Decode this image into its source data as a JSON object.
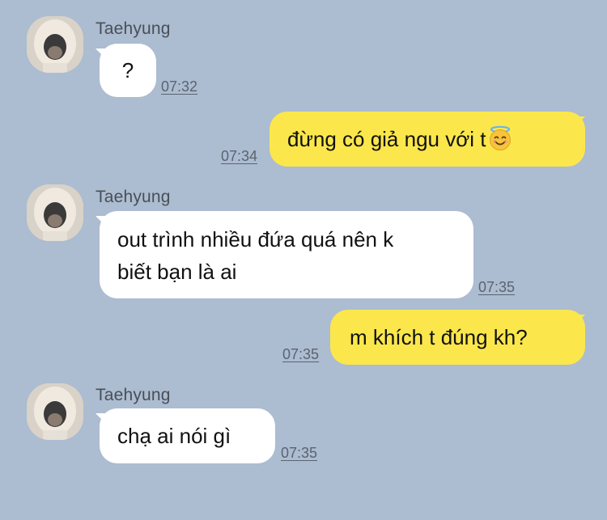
{
  "messages": [
    {
      "sender": "Taehyung",
      "text": "?",
      "time": "07:32"
    },
    {
      "text_prefix": "đừng có giả ngu với t",
      "emoji": "smiling-face-with-halo-emoji",
      "time": "07:34"
    },
    {
      "sender": "Taehyung",
      "line1": "out trình nhiều đứa quá nên k",
      "line2": "biết bạn là ai",
      "time": "07:35"
    },
    {
      "text": "m khích t đúng kh?",
      "time": "07:35"
    },
    {
      "sender": "Taehyung",
      "text": "chạ ai nói gì",
      "time": "07:35"
    }
  ],
  "colors": {
    "background": "#acbcd1",
    "incoming_bubble": "#ffffff",
    "outgoing_bubble": "#fbe74c",
    "timestamp": "#5b6470"
  }
}
